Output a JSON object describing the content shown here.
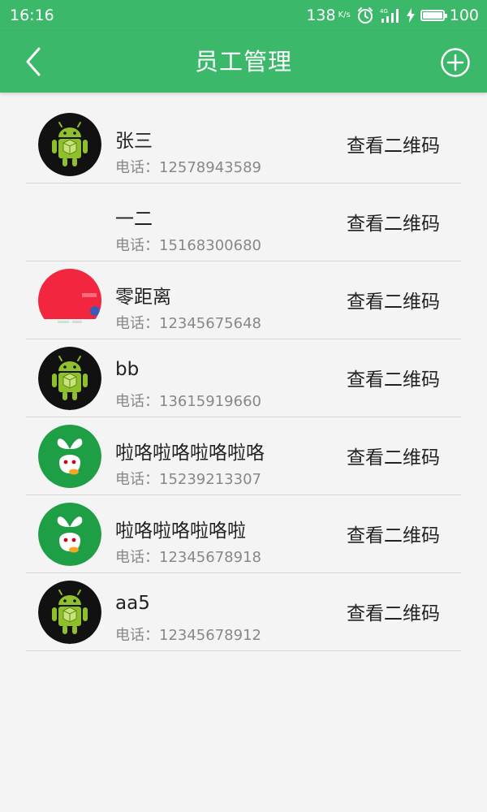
{
  "status_bar": {
    "time": "16:16",
    "net_speed": "138",
    "net_speed_unit": "K/s",
    "battery_level": "100",
    "battery_fraction": 1.0
  },
  "header": {
    "title": "员工管理",
    "back_icon": "chevron-left-icon",
    "add_icon": "plus-circle-icon"
  },
  "employees": [
    {
      "name": "张三",
      "phone": "电话：12578943589",
      "action": "查看二维码",
      "avatar": "android-avatar"
    },
    {
      "name": "一二",
      "phone": "电话：15168300680",
      "action": "查看二维码",
      "avatar": "blank-avatar"
    },
    {
      "name": "零距离",
      "phone": "电话：12345675648",
      "action": "查看二维码",
      "avatar": "red-screenshot-avatar"
    },
    {
      "name": "bb",
      "phone": "电话：13615919660",
      "action": "查看二维码",
      "avatar": "android-avatar"
    },
    {
      "name": "啦咯啦咯啦咯啦咯",
      "phone": "电话：15239213307",
      "action": "查看二维码",
      "avatar": "sprout-avatar"
    },
    {
      "name": "啦咯啦咯啦咯啦",
      "phone": "电话：12345678918",
      "action": "查看二维码",
      "avatar": "sprout-avatar"
    },
    {
      "name": "aa5",
      "phone": "电话：12345678912",
      "action": "查看二维码",
      "avatar": "android-avatar"
    }
  ],
  "colors": {
    "primary": "#3bb86a",
    "background": "#f4f4f4",
    "divider": "#d6d6d6",
    "text_primary": "#222222",
    "text_secondary": "#888888"
  }
}
